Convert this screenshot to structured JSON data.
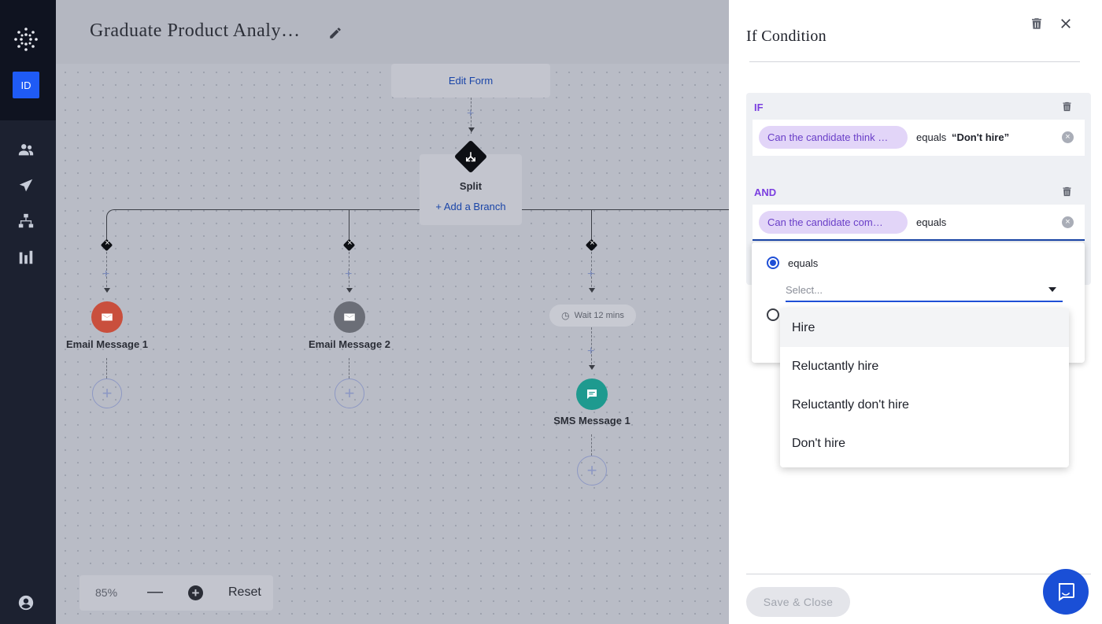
{
  "nav": {
    "badge": "ID",
    "icons": [
      "logo-icon",
      "people-icon",
      "send-icon",
      "org-chart-icon",
      "bar-chart-icon",
      "account-icon"
    ]
  },
  "canvas": {
    "title": "Graduate Product Analy…",
    "edit_form": "Edit Form",
    "split": {
      "label": "Split",
      "add_branch": "+ Add a Branch"
    },
    "nodes": [
      {
        "label": "Email Message 1",
        "color": "#c94f3d",
        "icon": "mail-icon"
      },
      {
        "label": "Email Message 2",
        "color": "#6b6e77",
        "icon": "mail-icon"
      },
      {
        "label": "SMS Message 1",
        "color": "#1e9a8f",
        "icon": "chat-icon"
      }
    ],
    "wait": "Wait 12 mins",
    "zoom": {
      "percent": "85%",
      "minus": "—",
      "plus": "+",
      "reset": "Reset"
    }
  },
  "panel": {
    "title": "If Condition",
    "if_keyword": "IF",
    "and_keyword": "AND",
    "conditions": [
      {
        "field": "Can the candidate think …",
        "operator": "equals",
        "value": "“Don't hire”"
      },
      {
        "field": "Can the candidate com…",
        "operator": "equals",
        "value": ""
      }
    ],
    "operator_menu": {
      "selected": "equals",
      "select_placeholder": "Select..."
    },
    "options": [
      "Hire",
      "Reluctantly hire",
      "Reluctantly don't hire",
      "Don't hire"
    ],
    "save_close": "Save & Close"
  },
  "colors": {
    "accent": "#1f4fd6",
    "purple": "#7b3fe0",
    "chip_bg": "#e2d5f8"
  }
}
